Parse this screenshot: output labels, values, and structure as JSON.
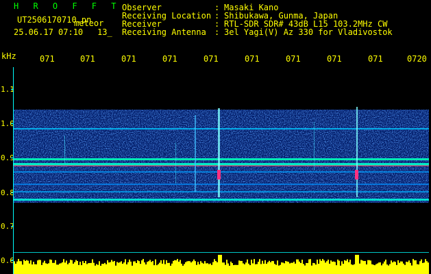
{
  "header": {
    "title": "H R O F F T",
    "filename": "UT2506170710.pn",
    "meteor_label": "meteor",
    "datetime": "25.06.17 07:10",
    "count": "13_",
    "rows": [
      {
        "label": "Observer",
        "value": "Masaki Kano"
      },
      {
        "label": "Receiving Location",
        "value": "Shibukawa, Gunma, Japan"
      },
      {
        "label": "Receiver",
        "value": "RTL-SDR SDR# 43dB L15 103.2MHz CW"
      },
      {
        "label": "Receiving Antenna",
        "value": "3el Yagi(V) Az 330 for Vladivostok"
      }
    ],
    "separator": ":"
  },
  "axes": {
    "y_unit": "kHz",
    "y_ticks": [
      "1.1",
      "1.0",
      "0.9",
      "0.8",
      "0.7",
      "0.6"
    ],
    "x_ticks": [
      "071",
      "071",
      "071",
      "071",
      "071",
      "071",
      "071",
      "071",
      "071",
      "0720"
    ]
  },
  "colors": {
    "text": "#ffff00",
    "title": "#00ff00",
    "axis": "#00ffff",
    "background": "#000000"
  }
}
